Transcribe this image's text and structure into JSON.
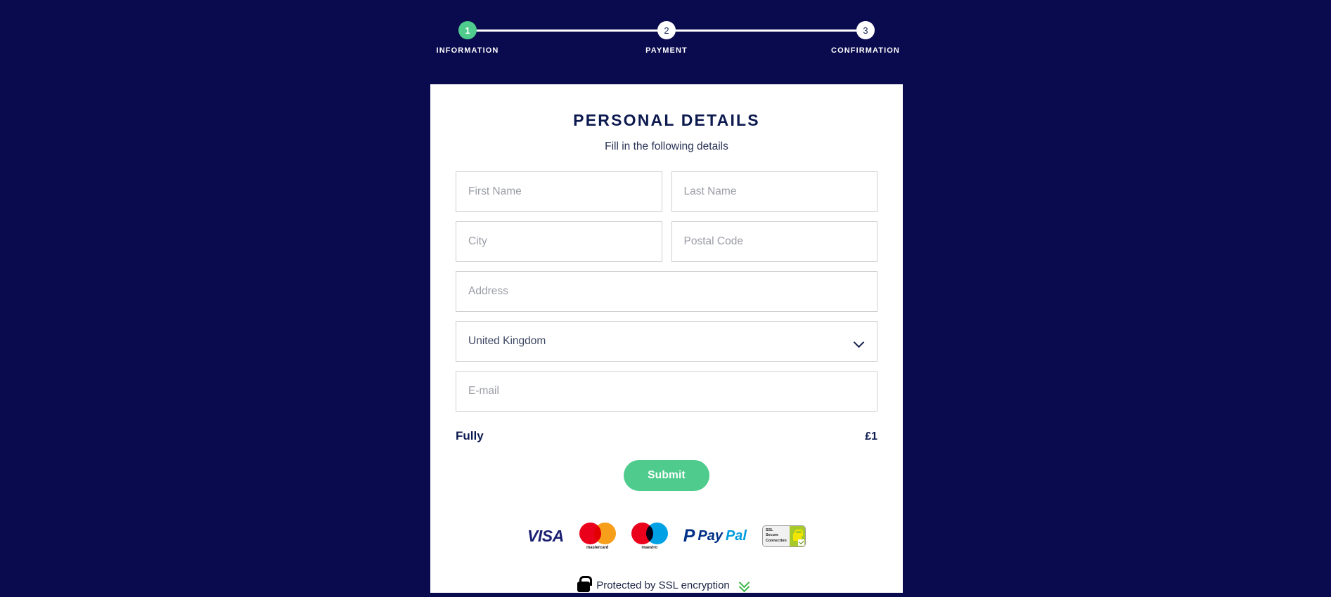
{
  "theme": {
    "background": "#0a0a4e",
    "card_background": "#ffffff",
    "accent_green": "#4ecb8d",
    "navy_text": "#0d1a4f",
    "placeholder": "#9a9da5",
    "border": "#cfd0d4"
  },
  "stepper": {
    "steps": [
      {
        "number": "1",
        "label": "INFORMATION",
        "state": "active"
      },
      {
        "number": "2",
        "label": "PAYMENT",
        "state": "inactive"
      },
      {
        "number": "3",
        "label": "CONFIRMATION",
        "state": "inactive"
      }
    ]
  },
  "card": {
    "title": "PERSONAL DETAILS",
    "subtitle": "Fill in the following details"
  },
  "form": {
    "first_name": {
      "placeholder": "First Name",
      "value": ""
    },
    "last_name": {
      "placeholder": "Last Name",
      "value": ""
    },
    "city": {
      "placeholder": "City",
      "value": ""
    },
    "postal_code": {
      "placeholder": "Postal Code",
      "value": ""
    },
    "address": {
      "placeholder": "Address",
      "value": ""
    },
    "country": {
      "selected": "United Kingdom",
      "icon": "chevron-down-icon"
    },
    "email": {
      "placeholder": "E-mail",
      "value": ""
    }
  },
  "total": {
    "label": "Fully",
    "price": "£1"
  },
  "submit": {
    "label": "Submit"
  },
  "payment_logos": [
    {
      "name": "visa",
      "text": "VISA"
    },
    {
      "name": "mastercard",
      "text": "mastercard"
    },
    {
      "name": "maestro",
      "text": "maestro"
    },
    {
      "name": "paypal",
      "mark": "P",
      "text_dark": "Pay",
      "text_light": "Pal"
    },
    {
      "name": "ssl-secure-connection",
      "line1": "SSL",
      "line2": "Secure",
      "line3": "Connection"
    }
  ],
  "ssl_footer": {
    "text": "Protected by SSL encryption",
    "lock_icon": "padlock-icon",
    "chevron_icon": "double-chevron-down-icon"
  }
}
